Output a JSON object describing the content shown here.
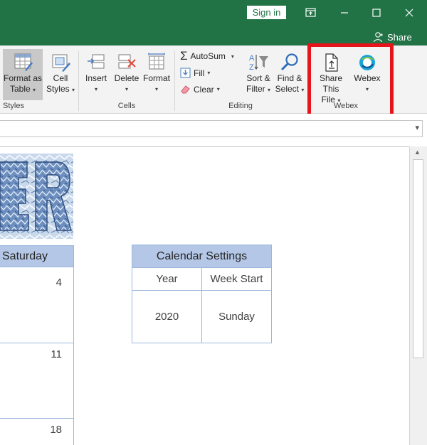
{
  "titlebar": {
    "signin_label": "Sign in",
    "icons": [
      "ribbon-display-options-icon",
      "minimize-icon",
      "maximize-icon",
      "close-icon"
    ]
  },
  "tabrow": {
    "share_label": "Share"
  },
  "ribbon": {
    "styles_group": {
      "format_as_table_line1": "Format as",
      "format_as_table_line2": "Table",
      "cell_styles_line1": "Cell",
      "cell_styles_line2": "Styles",
      "label": "Styles"
    },
    "cells_group": {
      "insert_label": "Insert",
      "delete_label": "Delete",
      "format_label": "Format",
      "label": "Cells"
    },
    "editing_group": {
      "autosum_label": "AutoSum",
      "fill_label": "Fill",
      "clear_label": "Clear",
      "sort_filter_line1": "Sort &",
      "sort_filter_line2": "Filter",
      "find_select_line1": "Find &",
      "find_select_line2": "Select",
      "label": "Editing"
    },
    "webex_group": {
      "share_file_line1": "Share This",
      "share_file_line2": "File",
      "webex_label": "Webex",
      "label": "Webex"
    },
    "accent_color": "#217346",
    "highlight_color": "#e8141b"
  },
  "sheet": {
    "calendar": {
      "day_header": "Saturday",
      "dates": [
        "4",
        "11",
        "18"
      ]
    },
    "settings": {
      "title": "Calendar Settings",
      "col1_header": "Year",
      "col2_header": "Week Start",
      "year_value": "2020",
      "week_start_value": "Sunday"
    },
    "header_color": "#b4c7e7"
  }
}
